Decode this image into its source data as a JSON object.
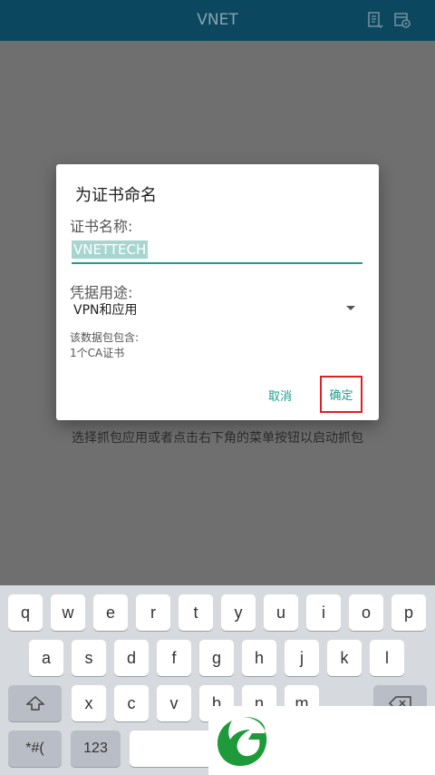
{
  "appbar": {
    "title": "VNET",
    "icons": [
      "note-list-icon",
      "calendar-settings-icon"
    ]
  },
  "background": {
    "hint": "选择抓包应用或者点击右下角的菜单按钮以启动抓包"
  },
  "dialog": {
    "title": "为证书命名",
    "name_label": "证书名称:",
    "name_value": "VNETTECH",
    "purpose_label": "凭据用途:",
    "purpose_value": "VPN和应用",
    "contains_label": "该数据包包含:",
    "contains_value": "1个CA证书",
    "cancel": "取消",
    "ok": "确定"
  },
  "keyboard": {
    "row1": [
      "q",
      "w",
      "e",
      "r",
      "t",
      "y",
      "u",
      "i",
      "o",
      "p"
    ],
    "row2": [
      "a",
      "s",
      "d",
      "f",
      "g",
      "h",
      "j",
      "k",
      "l"
    ],
    "row3": [
      "x",
      "c",
      "v",
      "b",
      "n",
      "m"
    ],
    "sym": "*#(",
    "num": "123"
  },
  "colors": {
    "appbar": "#0b4860",
    "accent": "#1f9e8c",
    "highlight_border": "#e02020",
    "logo": "#1f9a3a"
  }
}
